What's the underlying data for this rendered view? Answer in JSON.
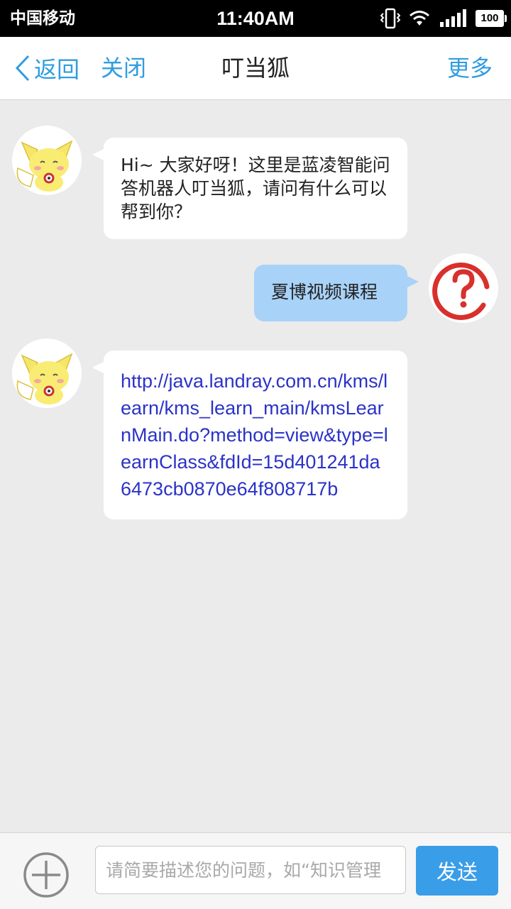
{
  "status_bar": {
    "carrier": "中国移动",
    "time": "11:40AM",
    "battery": "100"
  },
  "nav": {
    "back_label": "返回",
    "close_label": "关闭",
    "title": "叮当狐",
    "more_label": "更多"
  },
  "messages": [
    {
      "sender": "bot",
      "text": "Hi~ 大家好呀！这里是蓝凌智能问答机器人叮当狐，请问有什么可以帮到你？"
    },
    {
      "sender": "user",
      "text": "夏博视频课程"
    },
    {
      "sender": "bot",
      "type": "link",
      "text": "http://java.landray.com.cn/kms/learn/kms_learn_main/kmsLearnMain.do?method=view&type=learnClass&fdId=15d401241da6473cb0870e64f808717b"
    }
  ],
  "input": {
    "placeholder": "请简要描述您的问题，如“知识管理",
    "value": ""
  },
  "send_label": "发送",
  "colors": {
    "accent": "#2f9de0",
    "send_button": "#3a9de7",
    "user_bubble": "#a8d2f8",
    "link": "#2b33c7",
    "background": "#ebebeb"
  },
  "icons": {
    "bot_avatar": "fox-mascot-icon",
    "user_avatar": "question-mark-icon",
    "plus": "plus-circle-icon"
  }
}
